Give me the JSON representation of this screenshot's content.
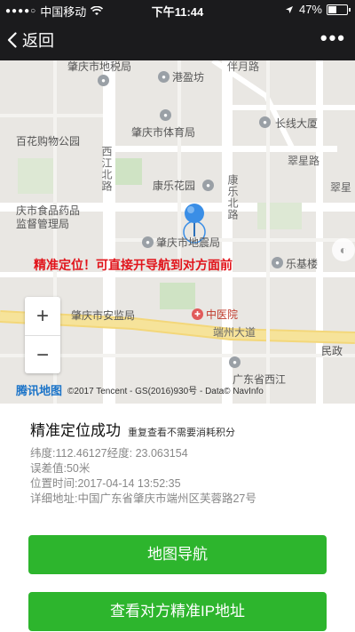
{
  "status_bar": {
    "carrier": "中国移动",
    "time": "下午11:44",
    "battery": "47%",
    "battery_level": 0.47
  },
  "nav": {
    "back_label": "返回",
    "more_label": "•••"
  },
  "map": {
    "banner": "精准定位！可直接开导航到对方面前",
    "credits": "©2017 Tencent - GS(2016)930号 - Data© NavInfo",
    "logo_text": "腾讯地图",
    "zoom_in": "+",
    "zoom_out": "−",
    "labels": {
      "zhaoqing_tax": "肇庆市地税局",
      "gangying_square": "港盈坊",
      "bansheng_road": "伴月路",
      "baihua_mall": "百花购物公园",
      "sports_bureau": "肇庆市体育局",
      "changxing_building": "长线大厦",
      "cuixing_road": "翠星路",
      "cuixing_short": "翠星",
      "xijiang_north": "西江北路",
      "kangle_garden": "康乐花园",
      "kangle_north": "康乐北路",
      "food_drug": "庆市食品药品",
      "supervision": "监督管理局",
      "earthquake_bureau": "肇庆市地震局",
      "leji_building": "乐基楼",
      "public_security": "肇庆市安监局",
      "tcm_hospital": "中医院",
      "duanzhou_road": "端州大道",
      "minzheng": "民政",
      "guangdong_xijiang": "广东省西江"
    }
  },
  "panel": {
    "title": "精准定位成功",
    "subtitle": "重复查看不需要消耗积分",
    "lines": [
      "纬度:112.46127经度: 23.063154",
      "误差值:50米",
      "位置时间:2017-04-14 13:52:35",
      "详细地址:中国广东省肇庆市端州区芙蓉路27号"
    ],
    "buttons": {
      "navigate": "地图导航",
      "view_ip": "查看对方精准IP地址"
    }
  },
  "colors": {
    "bar_bg": "#1b1b1d",
    "button_green": "#2db52d",
    "banner_red": "#e1141b",
    "marker_blue": "#3a8ee6"
  }
}
